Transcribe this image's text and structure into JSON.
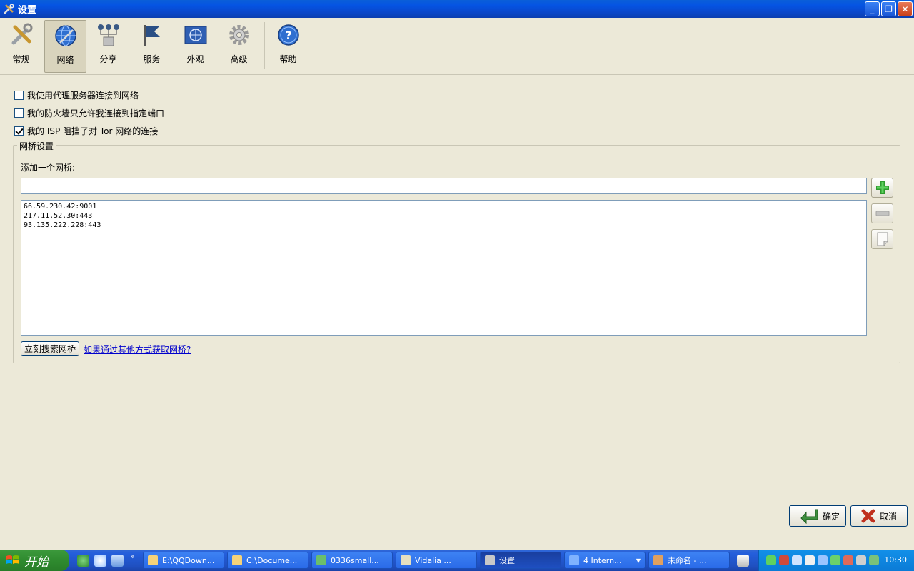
{
  "window": {
    "title": "设置",
    "controls": [
      "minimize",
      "restore",
      "close"
    ]
  },
  "toolbar": {
    "items": [
      {
        "label": "常规",
        "icon": "tools-icon",
        "active": false
      },
      {
        "label": "网络",
        "icon": "network-globe-icon",
        "active": true
      },
      {
        "label": "分享",
        "icon": "share-nodes-icon",
        "active": false
      },
      {
        "label": "服务",
        "icon": "flag-icon",
        "active": false
      },
      {
        "label": "外观",
        "icon": "appearance-globe-icon",
        "active": false
      },
      {
        "label": "高级",
        "icon": "gear-icon",
        "active": false
      },
      {
        "label": "帮助",
        "icon": "help-icon",
        "active": false
      }
    ]
  },
  "options": {
    "proxy": {
      "label": "我使用代理服务器连接到网络",
      "checked": false
    },
    "firewall": {
      "label": "我的防火墙只允许我连接到指定端口",
      "checked": false
    },
    "isp_block": {
      "label": "我的 ISP 阻挡了对 Tor 网络的连接",
      "checked": true
    }
  },
  "bridges": {
    "group_title": "网桥设置",
    "add_label": "添加一个网桥:",
    "input_value": "",
    "list": [
      "66.59.230.42:9001",
      "217.11.52.30:443",
      "93.135.222.228:443"
    ],
    "find_button": "立刻搜索网桥",
    "help_link": "如果通过其他方式获取网桥?"
  },
  "dialog": {
    "ok_label": "确定",
    "cancel_label": "取消"
  },
  "taskbar": {
    "start_label": "开始",
    "tasks": [
      {
        "label": "E:\\QQDown...",
        "active": false
      },
      {
        "label": "C:\\Docume...",
        "active": false
      },
      {
        "label": "0336small...",
        "active": false
      },
      {
        "label": "Vidalia ...",
        "active": false
      },
      {
        "label": "设置",
        "active": true
      },
      {
        "label": "4 Intern...",
        "active": false
      },
      {
        "label": "未命名 - ...",
        "active": false
      }
    ],
    "clock": "10:30"
  },
  "colors": {
    "titlebar": "#0554e3",
    "face": "#ece9d8",
    "link": "#0000cc",
    "taskbar": "#245edb",
    "start": "#2f8b2f",
    "tray": "#0b7bd6"
  }
}
